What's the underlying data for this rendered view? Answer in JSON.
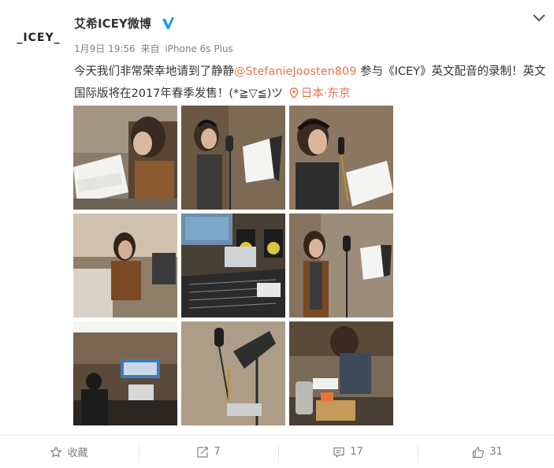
{
  "post": {
    "avatar_text": "_ICEY_",
    "username": "艾希ICEY微博",
    "date": "1月9日 19:56",
    "source_prefix": "来自",
    "source": "iPhone 6s Plus",
    "text_before": "今天我们非常荣幸地请到了静静",
    "mention": "@StefanieJoosten809",
    "text_after": " 参与《ICEY》英文配音的录制！英文国际版将在2017年春季发售！(*≧▽≦)ツ",
    "location": "日本·东京"
  },
  "photos": [
    {
      "name": "photo-1"
    },
    {
      "name": "photo-2"
    },
    {
      "name": "photo-3"
    },
    {
      "name": "photo-4"
    },
    {
      "name": "photo-5"
    },
    {
      "name": "photo-6"
    },
    {
      "name": "photo-7"
    },
    {
      "name": "photo-8"
    },
    {
      "name": "photo-9"
    }
  ],
  "actions": {
    "favorite_label": "收藏",
    "repost_count": "7",
    "comment_count": "17",
    "like_count": "31"
  },
  "colors": {
    "accent": "#eb7350",
    "verified": "#1a9be6",
    "meta": "#808080"
  }
}
